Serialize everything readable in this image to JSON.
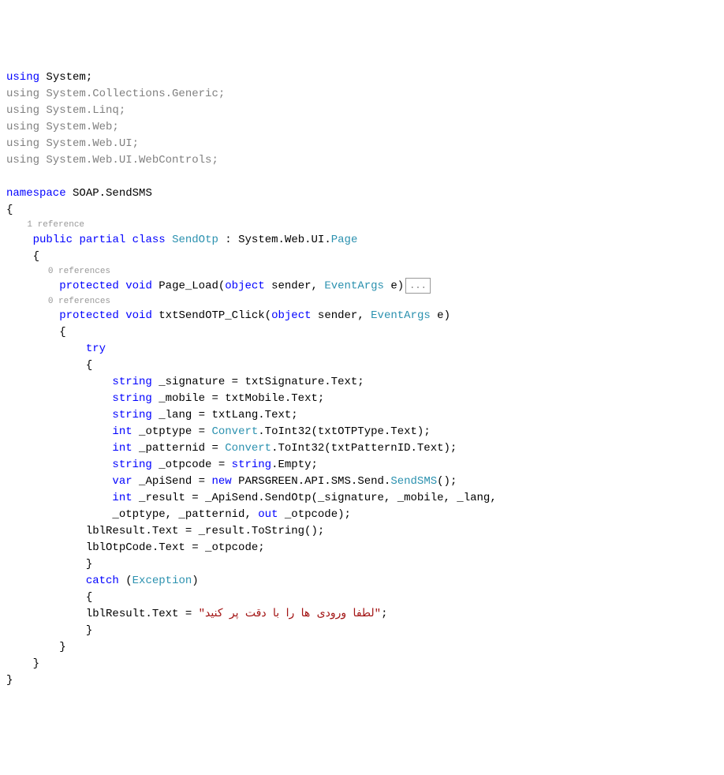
{
  "usings": {
    "active": "using System;",
    "faded": [
      "using System.Collections.Generic;",
      "using System.Linq;",
      "using System.Web;",
      "using System.Web.UI;",
      "using System.Web.UI.WebControls;"
    ]
  },
  "namespace_kw": "namespace",
  "namespace_name": " SOAP.SendSMS",
  "codelens_1ref": "1 reference",
  "codelens_0ref": "0 references",
  "class_decl": {
    "public": "public",
    "partial": "partial",
    "class": "class",
    "name": "SendOtp",
    "colon": " : ",
    "base_ns": "System.Web.UI.",
    "base_type": "Page"
  },
  "method1": {
    "protected": "protected",
    "void": "void",
    "name": " Page_Load(",
    "object": "object",
    "sender": " sender, ",
    "eventargs": "EventArgs",
    "e": " e)"
  },
  "collapse": "...",
  "method2": {
    "protected": "protected",
    "void": "void",
    "name": " txtSendOTP_Click(",
    "object": "object",
    "sender": " sender, ",
    "eventargs": "EventArgs",
    "e": " e)"
  },
  "body": {
    "try": "try",
    "line1_a": "string",
    "line1_b": " _signature = txtSignature.Text;",
    "line2_a": "string",
    "line2_b": " _mobile = txtMobile.Text;",
    "line3_a": "string",
    "line3_b": " _lang = txtLang.Text;",
    "line4_a": "int",
    "line4_b": " _otptype = ",
    "line4_c": "Convert",
    "line4_d": ".ToInt32(txtOTPType.Text);",
    "line5_a": "int",
    "line5_b": " _patternid = ",
    "line5_c": "Convert",
    "line5_d": ".ToInt32(txtPatternID.Text);",
    "line6_a": "string",
    "line6_b": " _otpcode = ",
    "line6_c": "string",
    "line6_d": ".Empty;",
    "line7_a": "var",
    "line7_b": " _ApiSend = ",
    "line7_c": "new",
    "line7_d": " PARSGREEN.API.SMS.Send.",
    "line7_e": "SendSMS",
    "line7_f": "();",
    "line8_a": "int",
    "line8_b": " _result = _ApiSend.SendOtp(_signature, _mobile, _lang,",
    "line8_c": "                _otptype, _patternid, ",
    "line8_d": "out",
    "line8_e": " _otpcode);",
    "line9": "            lblResult.Text = _result.ToString();",
    "line10": "            lblOtpCode.Text = _otpcode;",
    "catch": "catch",
    "catch_open": " (",
    "exception": "Exception",
    "catch_close": ")",
    "err_a": "            lblResult.Text = ",
    "err_b": "\"لطفا ورودی ها را با دقت پر کنید\"",
    "err_c": ";"
  },
  "braces": {
    "open": "{",
    "close": "}"
  }
}
